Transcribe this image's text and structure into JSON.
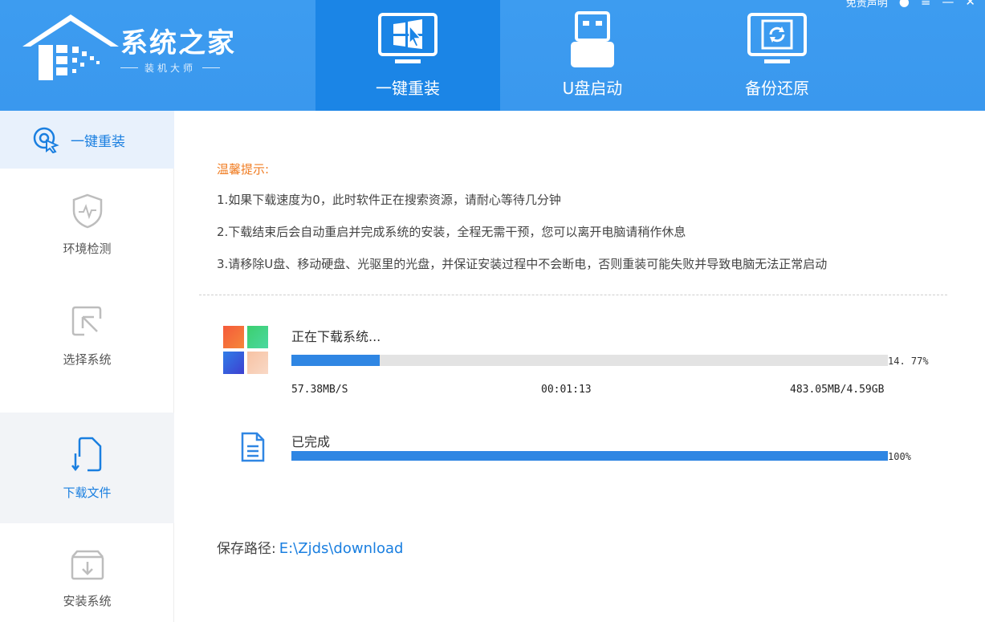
{
  "window": {
    "disclaimer": "免责声明",
    "menu_glyph": "≡",
    "minimize_glyph": "—",
    "close_glyph": "✕"
  },
  "brand": {
    "title": "系统之家",
    "subtitle": "装机大师"
  },
  "top_nav": {
    "tabs": [
      {
        "label": "一键重装",
        "icon": "windows-monitor-icon",
        "active": true
      },
      {
        "label": "U盘启动",
        "icon": "usb-drive-icon",
        "active": false
      },
      {
        "label": "备份还原",
        "icon": "backup-restore-icon",
        "active": false
      }
    ]
  },
  "sidebar": {
    "header": {
      "label": "一键重装",
      "icon": "reinstall-icon"
    },
    "items": [
      {
        "label": "环境检测",
        "icon": "shield-heartbeat-icon"
      },
      {
        "label": "选择系统",
        "icon": "select-cursor-icon"
      },
      {
        "label": "下载文件",
        "icon": "download-file-icon",
        "selected": true
      },
      {
        "label": "安装系统",
        "icon": "install-box-icon"
      }
    ]
  },
  "tips": {
    "title": "温馨提示:",
    "lines": [
      "1.如果下载速度为0，此时软件正在搜索资源，请耐心等待几分钟",
      "2.下载结束后会自动重启并完成系统的安装，全程无需干预，您可以离开电脑请稍作休息",
      "3.请移除U盘、移动硬盘、光驱里的光盘，并保证安装过程中不会断电，否则重装可能失败并导致电脑无法正常启动"
    ]
  },
  "download": {
    "status": "正在下载系统...",
    "percent_text": "14. 77%",
    "progress": 0.1477,
    "speed": "57.38MB/S",
    "elapsed": "00:01:13",
    "size": "483.05MB/4.59GB"
  },
  "completed": {
    "status": "已完成",
    "percent_text": "100%",
    "progress": 1.0
  },
  "save": {
    "label": "保存路径:",
    "path": "E:\\Zjds\\download"
  },
  "colors": {
    "header_bg": "#3d9cf0",
    "active_tab": "#1b85e6",
    "accent_blue": "#1a7fe0",
    "tip_orange": "#f07c22",
    "bar_fill": "#2f86e3",
    "bar_track": "#e3e3e3"
  }
}
